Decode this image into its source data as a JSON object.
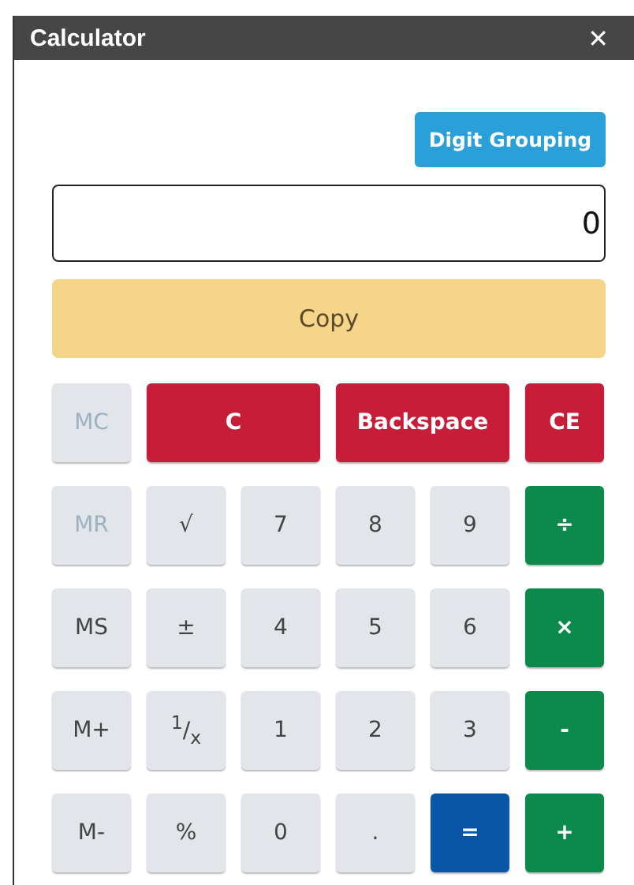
{
  "window": {
    "title": "Calculator",
    "close": "✕"
  },
  "digit_grouping": {
    "label": "Digit Grouping"
  },
  "display": {
    "value": "0"
  },
  "copy": {
    "label": "Copy"
  },
  "keys": [
    {
      "label": "MC",
      "kind": "memory",
      "disabled": true,
      "wide": false
    },
    {
      "label": "C",
      "kind": "clear",
      "disabled": false,
      "wide": true
    },
    {
      "label": "Backspace",
      "kind": "clear",
      "disabled": false,
      "wide": true
    },
    {
      "label": "CE",
      "kind": "clear",
      "disabled": false,
      "wide": false
    },
    {
      "label": "MR",
      "kind": "memory",
      "disabled": true,
      "wide": false
    },
    {
      "label": "√",
      "kind": "function",
      "disabled": false,
      "wide": false
    },
    {
      "label": "7",
      "kind": "digit",
      "disabled": false,
      "wide": false
    },
    {
      "label": "8",
      "kind": "digit",
      "disabled": false,
      "wide": false
    },
    {
      "label": "9",
      "kind": "digit",
      "disabled": false,
      "wide": false
    },
    {
      "label": "÷",
      "kind": "operator",
      "disabled": false,
      "wide": false
    },
    {
      "label": "MS",
      "kind": "memory",
      "disabled": false,
      "wide": false
    },
    {
      "label": "±",
      "kind": "function",
      "disabled": false,
      "wide": false
    },
    {
      "label": "4",
      "kind": "digit",
      "disabled": false,
      "wide": false
    },
    {
      "label": "5",
      "kind": "digit",
      "disabled": false,
      "wide": false
    },
    {
      "label": "6",
      "kind": "digit",
      "disabled": false,
      "wide": false
    },
    {
      "label": "×",
      "kind": "operator",
      "disabled": false,
      "wide": false
    },
    {
      "label": "M+",
      "kind": "memory",
      "disabled": false,
      "wide": false
    },
    {
      "label": "$^{1}$/$_{x}$",
      "kind": "function",
      "disabled": false,
      "wide": false
    },
    {
      "label": "1",
      "kind": "digit",
      "disabled": false,
      "wide": false
    },
    {
      "label": "2",
      "kind": "digit",
      "disabled": false,
      "wide": false
    },
    {
      "label": "3",
      "kind": "digit",
      "disabled": false,
      "wide": false
    },
    {
      "label": "-",
      "kind": "operator",
      "disabled": false,
      "wide": false
    },
    {
      "label": "M-",
      "kind": "memory",
      "disabled": false,
      "wide": false
    },
    {
      "label": "%",
      "kind": "function",
      "disabled": false,
      "wide": false
    },
    {
      "label": "0",
      "kind": "digit",
      "disabled": false,
      "wide": false
    },
    {
      "label": ".",
      "kind": "digit",
      "disabled": false,
      "wide": false
    },
    {
      "label": "=",
      "kind": "equals",
      "disabled": false,
      "wide": false
    },
    {
      "label": "+",
      "kind": "operator",
      "disabled": false,
      "wide": false
    }
  ]
}
